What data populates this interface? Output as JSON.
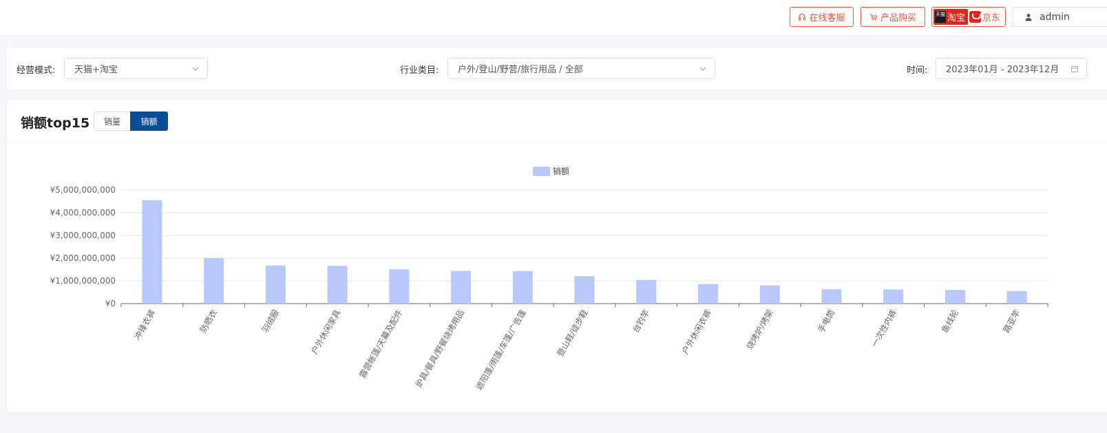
{
  "header": {
    "service_label": "在线客服",
    "buy_label": "产品购买",
    "tmall_badge": "天猫",
    "taobao_label": "淘宝",
    "jd_label": "京东",
    "user_name": "admin"
  },
  "filters": {
    "mode_label": "经营模式:",
    "mode_value": "天猫+淘宝",
    "category_label": "行业类目:",
    "category_value": "户外/登山/野营/旅行用品 / 全部",
    "time_label": "时间:",
    "time_value": "2023年01月 - 2023年12月"
  },
  "panel": {
    "title": "销额top15",
    "tab_qty": "销量",
    "tab_amount": "销额"
  },
  "colors": {
    "bar": "#b9c8fa",
    "accent": "#0b4c97",
    "danger": "#e8563a"
  },
  "chart_data": {
    "type": "bar",
    "legend": "销额",
    "legend_position": "top-center",
    "grid": true,
    "ylim": [
      0,
      5000000000
    ],
    "yticks": [
      "¥0",
      "¥1,000,000,000",
      "¥2,000,000,000",
      "¥3,000,000,000",
      "¥4,000,000,000",
      "¥5,000,000,000"
    ],
    "categories": [
      "冲锋衣裤",
      "防晒衣",
      "羽绒服",
      "户外休闲家具",
      "露营帐篷/天幕及配件",
      "炉具/餐具/野餐烧烤用品",
      "遮阳篷/雨篷/车篷/广告篷",
      "登山鞋/徒步鞋",
      "台钓竿",
      "户外休闲衣裤",
      "烧烤炉/烤架",
      "手电筒",
      "一次性内裤",
      "鱼线轮",
      "路亚竿"
    ],
    "series": [
      {
        "name": "销额",
        "values": [
          4550000000,
          2000000000,
          1680000000,
          1660000000,
          1510000000,
          1440000000,
          1430000000,
          1210000000,
          1040000000,
          860000000,
          800000000,
          630000000,
          620000000,
          600000000,
          550000000
        ]
      }
    ]
  }
}
